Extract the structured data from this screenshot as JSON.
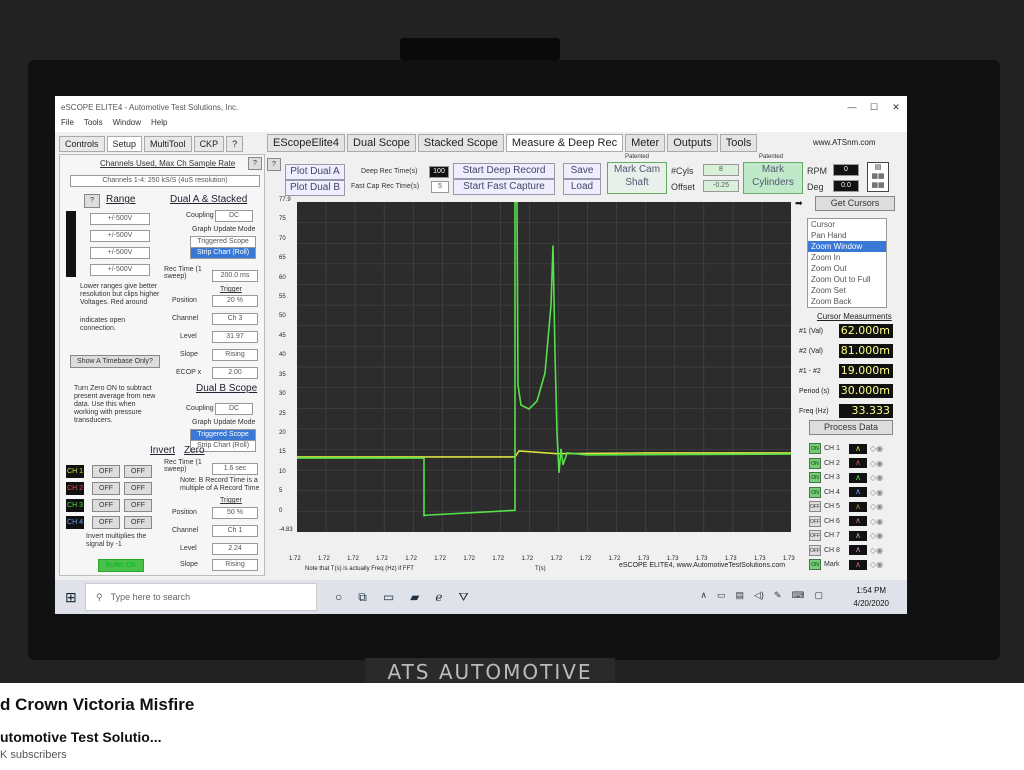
{
  "window": {
    "title": "eSCOPE ELITE4 - Automotive Test Solutions, Inc."
  },
  "menu": [
    "File",
    "Tools",
    "Window",
    "Help"
  ],
  "left_tabs": [
    "Controls",
    "Setup",
    "MultiTool",
    "CKP",
    "?"
  ],
  "main_tabs": [
    "EScopeElite4",
    "Dual Scope",
    "Stacked Scope",
    "Measure & Deep Rec",
    "Meter",
    "Outputs",
    "Tools"
  ],
  "website": "www.ATSnm.com",
  "left": {
    "channels_used": "Channels Used, Max Ch Sample Rate",
    "channels_value": "Channels 1-4: 250 kS/S (4uS resolution)",
    "range_label": "Range",
    "range_values": [
      "+/-500V",
      "+/-500V",
      "+/-500V",
      "+/-500V"
    ],
    "range_note": "Lower ranges give better resolution but clips higher Voltages. Red around",
    "range_note2": "indicates open connection.",
    "dual_a": "Dual A & Stacked",
    "coupling": "Coupling",
    "coupling_val": "DC",
    "graph_mode": "Graph Update Mode",
    "triggered": "Triggered Scope",
    "strip": "Strip Chart (Roll)",
    "rec_time": "Rec Time (1 sweep)",
    "rec_time_val": "200.0 ms",
    "trigger": "Trigger",
    "position": "Position",
    "position_val": "20 %",
    "channel": "Channel",
    "channel_val": "Ch 3",
    "level": "Level",
    "level_val": "31.97",
    "slope": "Slope",
    "slope_val": "Rising",
    "ecop": "ECOP x",
    "ecop_val": "2.00",
    "timebase_btn": "Show A Timebase Only?",
    "zero_note": "Turn Zero ON to subtract present average from new data. Use this when working with pressure transducers.",
    "dual_b": "Dual B Scope",
    "coupling_b_val": "DC",
    "rec_time_b_val": "1.6 sec",
    "b_note": "Note: B Record Time is a multiple of A Record Time",
    "position_b_val": "50 %",
    "channel_b_val": "Ch 1",
    "level_b_val": "2.24",
    "slope_b_val": "Rising",
    "invert": "Invert",
    "zero": "Zero",
    "ch_labels": [
      "CH 1",
      "CH 2",
      "CH 3",
      "CH 4"
    ],
    "off": "OFF",
    "invert_note": "Invert multiplies the signal by -1",
    "buffer_ok": "Buffer OK"
  },
  "toolbar": {
    "plot_dual_a": "Plot Dual A",
    "plot_dual_b": "Plot Dual B",
    "deep_rec_time": "Deep Rec Time(s)",
    "deep_rec_val": "100",
    "fast_cap_time": "Fast Cap Rec Time(s)",
    "fast_cap_val": "5",
    "start_deep": "Start Deep Record",
    "start_fast": "Start Fast Capture",
    "save": "Save",
    "load": "Load",
    "patented1": "Patented",
    "mark_cam": "Mark Cam Shaft",
    "cyls_label": "#Cyls",
    "cyls_val": "8",
    "offset_label": "Offset",
    "offset_val": "-0.25",
    "patented2": "Patented",
    "mark_cyl": "Mark Cylinders",
    "rpm_label": "RPM",
    "rpm_val": "0",
    "deg_label": "Deg",
    "deg_val": "0.0"
  },
  "plot": {
    "y_ticks": [
      "77.9",
      "75",
      "70",
      "65",
      "60",
      "55",
      "50",
      "45",
      "40",
      "35",
      "30",
      "25",
      "20",
      "15",
      "10",
      "5",
      "0",
      "-4.83"
    ],
    "x_ticks": [
      "1.72",
      "1.72",
      "1.72",
      "1.72",
      "1.72",
      "1.72",
      "1.72",
      "1.72",
      "1.72",
      "1.72",
      "1.72",
      "1.72",
      "1.73",
      "1.73",
      "1.73",
      "1.73",
      "1.73",
      "1.73"
    ],
    "x_note": "Note that T(s) is actually Freq (Hz) if FFT",
    "x_label": "T(s)",
    "footer": "eSCOPE ELITE4, www.AutomotiveTestSolutions.com",
    "colors": {
      "green": "#56e04a",
      "yellow": "#d8e040"
    }
  },
  "right": {
    "get_cursors": "Get Cursors",
    "cursor_modes": [
      "Cursor",
      "Pan Hand",
      "Zoom Window",
      "Zoom In",
      "Zoom Out",
      "Zoom Out to Full",
      "Zoom Set",
      "Zoom Back"
    ],
    "selected_mode": "Zoom Window",
    "meas_title": "Cursor Measurments",
    "meas": [
      {
        "label": "#1 (Val)",
        "value": "62.000m"
      },
      {
        "label": "#2 (Val)",
        "value": "81.000m"
      },
      {
        "label": "#1 - #2",
        "value": "19.000m"
      },
      {
        "label": "Period (s)",
        "value": "30.000m"
      },
      {
        "label": "Freq (Hz)",
        "value": "33.333"
      }
    ],
    "process_data": "Process Data",
    "channels": [
      {
        "state": "ON",
        "label": "CH 1"
      },
      {
        "state": "ON",
        "label": "CH 2"
      },
      {
        "state": "ON",
        "label": "CH 3"
      },
      {
        "state": "ON",
        "label": "CH 4"
      },
      {
        "state": "OFF",
        "label": "CH 5"
      },
      {
        "state": "OFF",
        "label": "CH 6"
      },
      {
        "state": "OFF",
        "label": "CH 7"
      },
      {
        "state": "OFF",
        "label": "CH 8"
      },
      {
        "state": "ON",
        "label": "Mark"
      }
    ]
  },
  "taskbar": {
    "search_placeholder": "Type here to search",
    "time": "1:54 PM",
    "date": "4/20/2020"
  },
  "bezel_brand": "ATS AUTOMOTIVE",
  "video": {
    "title": "d Crown Victoria Misfire",
    "channel": "utomotive Test Solutio...",
    "subs": "K subscribers"
  }
}
